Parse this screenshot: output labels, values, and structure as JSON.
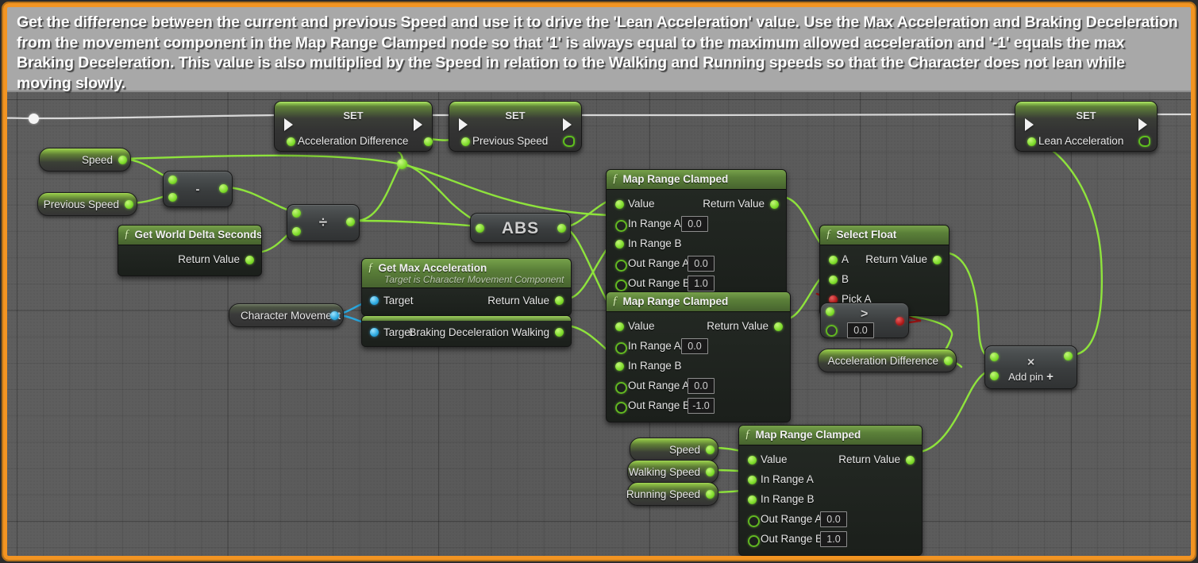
{
  "comment": {
    "text": "Get the difference between the current and previous Speed and use it to drive the 'Lean Acceleration' value. Use the Max Acceleration and Braking Deceleration from the movement component in the Map Range Clamped node so that '1' is always equal to the maximum allowed acceleration and '-1' equals the max Braking Deceleration. This value is also multiplied by the Speed in relation to the Walking and Running speeds so that the Character does not lean while moving slowly.",
    "frame_color": "#f29422",
    "banner_color": "#a8a8a8"
  },
  "graph": {
    "background_color": "#5c5c5c",
    "wire_color_exec": "#d8d8d8",
    "wire_color_float": "#8ee33c",
    "wire_color_object": "#29a8e0",
    "wire_color_bool": "#9e1414"
  },
  "nodes": {
    "set_acceleration_difference": {
      "title": "SET",
      "variable": "Acceleration Difference"
    },
    "set_previous_speed": {
      "title": "SET",
      "variable": "Previous Speed"
    },
    "set_lean_acceleration": {
      "title": "SET",
      "variable": "Lean Acceleration"
    },
    "get_speed": {
      "label": "Speed"
    },
    "get_previous_speed": {
      "label": "Previous Speed"
    },
    "get_speed_2": {
      "label": "Speed"
    },
    "get_walking_speed": {
      "label": "Walking Speed"
    },
    "get_running_speed": {
      "label": "Running Speed"
    },
    "get_acceleration_difference": {
      "label": "Acceleration Difference"
    },
    "get_character_movement": {
      "label": "Character Movement"
    },
    "subtract": {
      "glyph": "-"
    },
    "divide": {
      "glyph": "÷"
    },
    "multiply": {
      "glyph": "×",
      "add_pin": "Add pin",
      "add_pin_glyph": "+"
    },
    "greater_than": {
      "glyph": ">",
      "value_b": "0.0"
    },
    "abs": {
      "title": "ABS"
    },
    "get_world_delta_seconds": {
      "title": "Get World Delta Seconds",
      "return_label": "Return Value"
    },
    "get_max_acceleration": {
      "title": "Get Max Acceleration",
      "subtitle": "Target is Character Movement Component",
      "target_label": "Target",
      "return_label": "Return Value"
    },
    "braking_deceleration_walking": {
      "target_label": "Target",
      "return_label": "Braking Deceleration Walking"
    },
    "select_float": {
      "title": "Select Float",
      "pins": [
        "A",
        "B",
        "Pick A"
      ],
      "return_label": "Return Value"
    },
    "map_range_clamped_1": {
      "title": "Map Range Clamped",
      "return_label": "Return Value",
      "pins": [
        {
          "label": "Value",
          "value": null
        },
        {
          "label": "In Range A",
          "value": "0.0"
        },
        {
          "label": "In Range B",
          "value": null
        },
        {
          "label": "Out Range A",
          "value": "0.0"
        },
        {
          "label": "Out Range B",
          "value": "1.0"
        }
      ]
    },
    "map_range_clamped_2": {
      "title": "Map Range Clamped",
      "return_label": "Return Value",
      "pins": [
        {
          "label": "Value",
          "value": null
        },
        {
          "label": "In Range A",
          "value": "0.0"
        },
        {
          "label": "In Range B",
          "value": null
        },
        {
          "label": "Out Range A",
          "value": "0.0"
        },
        {
          "label": "Out Range B",
          "value": "-1.0"
        }
      ]
    },
    "map_range_clamped_3": {
      "title": "Map Range Clamped",
      "return_label": "Return Value",
      "pins": [
        {
          "label": "Value",
          "value": null
        },
        {
          "label": "In Range A",
          "value": null
        },
        {
          "label": "In Range B",
          "value": null
        },
        {
          "label": "Out Range A",
          "value": "0.0"
        },
        {
          "label": "Out Range B",
          "value": "1.0"
        }
      ]
    }
  }
}
